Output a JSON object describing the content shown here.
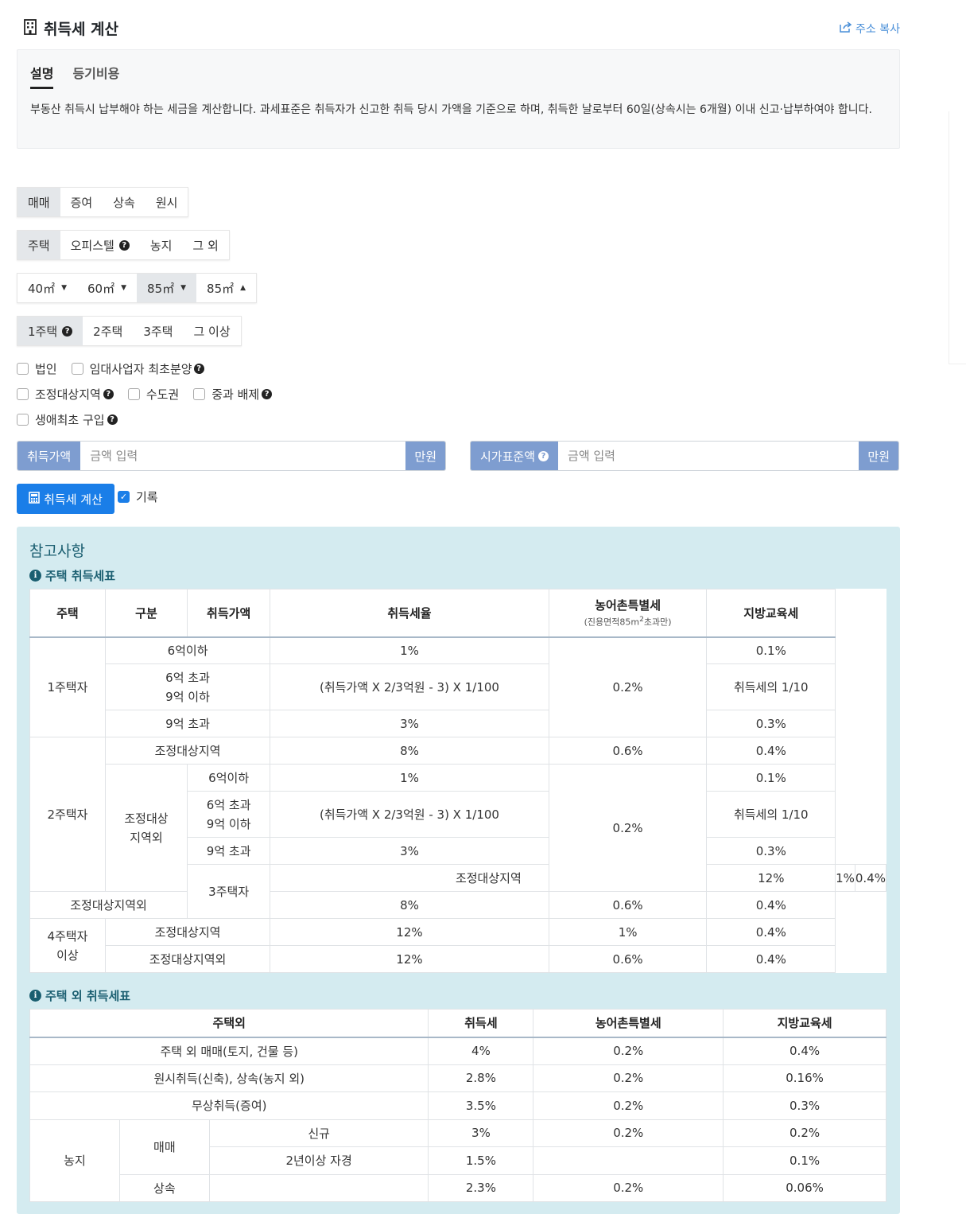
{
  "header": {
    "title": "취득세 계산",
    "copy_label": "주소 복사"
  },
  "info": {
    "tabs": [
      "설명",
      "등기비용"
    ],
    "description": "부동산 취득시 납부해야 하는 세금을 계산합니다. 과세표준은 취득자가 신고한 취득 당시 가액을 기준으로 하며, 취득한 날로부터 60일(상속시는 6개월) 이내 신고·납부하여야 합니다."
  },
  "options": {
    "acquisition_type": [
      "매매",
      "증여",
      "상속",
      "원시"
    ],
    "property_type": [
      "주택",
      "오피스텔",
      "농지",
      "그 외"
    ],
    "area": [
      "40㎡",
      "60㎡",
      "85㎡",
      "85㎡"
    ],
    "house_count": [
      "1주택",
      "2주택",
      "3주택",
      "그 이상"
    ]
  },
  "checkboxes": {
    "corporation": "법인",
    "rental_first_sale": "임대사업자 최초분양",
    "adjusted_area": "조정대상지역",
    "capital_area": "수도권",
    "exclude_heavy": "중과 배제",
    "first_home": "생애최초 구입"
  },
  "inputs": {
    "price_label": "취득가액",
    "price_placeholder": "금액 입력",
    "price_unit": "만원",
    "std_label": "시가표준액",
    "std_placeholder": "금액 입력",
    "std_unit": "만원"
  },
  "actions": {
    "calculate": "취득세 계산",
    "record": "기록"
  },
  "reference": {
    "title": "참고사항",
    "house_table_title": "주택 취득세표",
    "house_headers": {
      "house": "주택",
      "category": "구분",
      "price": "취득가액",
      "rate": "취득세율",
      "rural": "농어촌특별세",
      "rural_sub_prefix": "(진용면적85m",
      "rural_sub_sup": "2",
      "rural_sub_suffix": "초과만)",
      "edu": "지방교육세"
    },
    "house_rows": {
      "one_house": "1주택자",
      "le6": "6억이하",
      "r1": "1%",
      "e1": "0.1%",
      "gt6a": "6억 초과",
      "le9a": "9억 이하",
      "formula": "(취득가액 X 2/3억원 - 3) X 1/100",
      "e_formula": "취득세의 1/10",
      "gt9": "9억 초과",
      "r3": "3%",
      "e3": "0.3%",
      "rural_1": "0.2%",
      "two_house": "2주택자",
      "adj": "조정대상지역",
      "r8": "8%",
      "rural_06": "0.6%",
      "e4": "0.4%",
      "non_adj_a": "조정대상",
      "non_adj_b": "지역외",
      "rural_2": "0.2%",
      "three_house": "3주택자",
      "r12": "12%",
      "rural_1p": "1%",
      "non_adj": "조정대상지역외",
      "four_a": "4주택자",
      "four_b": "이상"
    },
    "other_table_title": "주택 외 취득세표",
    "other_headers": {
      "other": "주택외",
      "tax": "취득세",
      "rural": "농어촌특별세",
      "edu": "지방교육세"
    },
    "other_rows": [
      {
        "label": "주택 외 매매(토지, 건물 등)",
        "tax": "4%",
        "rural": "0.2%",
        "edu": "0.4%"
      },
      {
        "label": "원시취득(신축), 상속(농지 외)",
        "tax": "2.8%",
        "rural": "0.2%",
        "edu": "0.16%"
      },
      {
        "label": "무상취득(증여)",
        "tax": "3.5%",
        "rural": "0.2%",
        "edu": "0.3%"
      }
    ],
    "farmland": {
      "label": "농지",
      "sale": "매매",
      "inherit": "상속",
      "new": "신규",
      "new_tax": "3%",
      "new_rural": "0.2%",
      "new_edu": "0.2%",
      "farm2": "2년이상 자경",
      "farm2_tax": "1.5%",
      "farm2_edu": "0.1%",
      "inherit_tax": "2.3%",
      "inherit_rural": "0.2%",
      "inherit_edu": "0.06%"
    }
  }
}
